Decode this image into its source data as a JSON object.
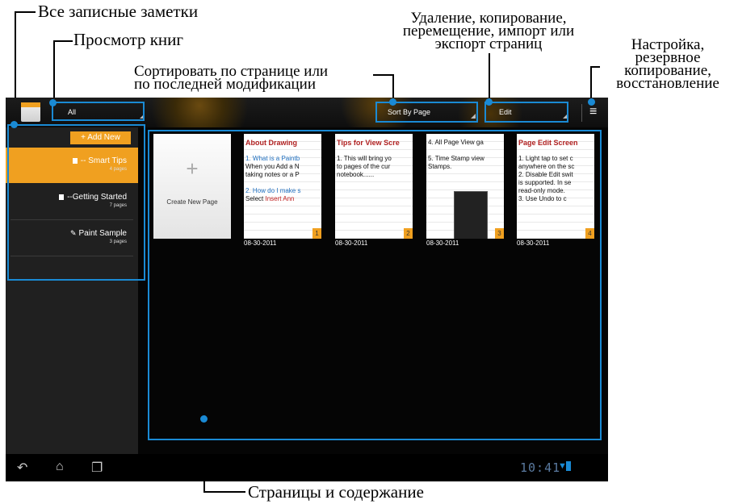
{
  "annotations": {
    "all_notebooks": "Все записные заметки",
    "view_books": "Просмотр книг",
    "sort_line1": "Сортировать по странице или",
    "sort_line2": "по последней модификации",
    "edit_line1": "Удаление, копирование,",
    "edit_line2": "перемещение, импорт или",
    "edit_line3": "экспорт страниц",
    "settings_line1": "Настройка,",
    "settings_line2": "резервное",
    "settings_line3": "копирование,",
    "settings_line4": "восстановление",
    "pages_content": "Страницы и содержание"
  },
  "topbar": {
    "filter_value": "All",
    "sort_value": "Sort By Page",
    "edit_value": "Edit",
    "menu_icon": "overflow-menu-icon"
  },
  "sidebar": {
    "add_new": "+ Add New",
    "books": [
      {
        "title": "-- Smart Tips",
        "pages": "4 pages"
      },
      {
        "title": "--Getting Started",
        "pages": "7 pages"
      },
      {
        "title": "Paint Sample",
        "pages": "3 pages"
      }
    ]
  },
  "content": {
    "create_label": "Create New Page",
    "pages": [
      {
        "lines": [
          "About Drawing",
          "1. What is a Paintb",
          "When you Add a N",
          "taking notes or a P",
          "2. How do I make s",
          "Select ",
          "Insert Ann"
        ],
        "num": "1",
        "date": "08-30-2011"
      },
      {
        "lines": [
          "Tips for View Scre",
          "1. This will bring yo",
          "to pages of the cur",
          "notebook......"
        ],
        "num": "2",
        "date": "08-30-2011"
      },
      {
        "lines": [
          "4. All Page View ga",
          "5. Time Stamp view",
          "Stamps."
        ],
        "num": "3",
        "date": "08-30-2011"
      },
      {
        "lines": [
          "Page Edit Screen",
          "1. Light tap to set c",
          "anywhere on the sc",
          "2. Disable Edit swit",
          "is supported. In se",
          "read-only mode.",
          "3. Use Undo to c"
        ],
        "num": "4",
        "date": "08-30-2011"
      }
    ]
  },
  "navbar": {
    "clock": "10:41"
  },
  "colors": {
    "accent": "#f0a020",
    "annotation_blue": "#1a8ad4"
  }
}
